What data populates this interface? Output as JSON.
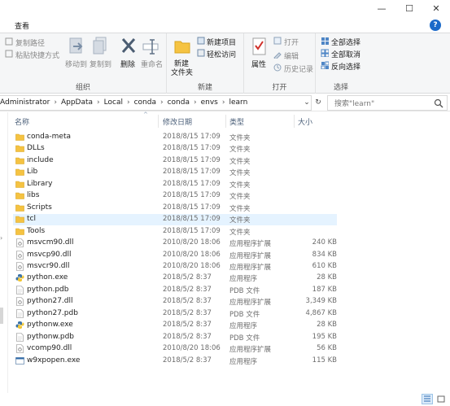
{
  "window": {
    "minimize": "—",
    "maximize": "☐",
    "close": "✕",
    "tab_label": "查看",
    "help": "?"
  },
  "ribbon": {
    "clipboard": {
      "copy_path": "复制路径",
      "paste_shortcut": "粘贴快捷方式",
      "move_to": "移动到",
      "copy_to": "复制到",
      "group_label": "组织"
    },
    "organize": {
      "delete": "删除",
      "rename": "重命名"
    },
    "new": {
      "new_folder_line1": "新建",
      "new_folder_line2": "文件夹",
      "new_item": "新建项目",
      "easy_access": "轻松访问",
      "group_label": "新建"
    },
    "open": {
      "properties": "属性",
      "open": "打开",
      "edit": "编辑",
      "history": "历史记录",
      "group_label": "打开"
    },
    "select": {
      "select_all": "全部选择",
      "select_none": "全部取消",
      "invert": "反向选择",
      "group_label": "选择"
    }
  },
  "address": {
    "crumbs": [
      "Administrator",
      "AppData",
      "Local",
      "conda",
      "conda",
      "envs",
      "learn"
    ],
    "search_placeholder": "搜索\"learn\""
  },
  "columns": {
    "name": "名称",
    "date": "修改日期",
    "type": "类型",
    "size": "大小"
  },
  "files": [
    {
      "name": "conda-meta",
      "date": "2018/8/15 17:09",
      "type": "文件夹",
      "size": "",
      "icon": "folder-icon"
    },
    {
      "name": "DLLs",
      "date": "2018/8/15 17:09",
      "type": "文件夹",
      "size": "",
      "icon": "folder-icon"
    },
    {
      "name": "include",
      "date": "2018/8/15 17:09",
      "type": "文件夹",
      "size": "",
      "icon": "folder-icon"
    },
    {
      "name": "Lib",
      "date": "2018/8/15 17:09",
      "type": "文件夹",
      "size": "",
      "icon": "folder-icon"
    },
    {
      "name": "Library",
      "date": "2018/8/15 17:09",
      "type": "文件夹",
      "size": "",
      "icon": "folder-icon"
    },
    {
      "name": "libs",
      "date": "2018/8/15 17:09",
      "type": "文件夹",
      "size": "",
      "icon": "folder-icon"
    },
    {
      "name": "Scripts",
      "date": "2018/8/15 17:09",
      "type": "文件夹",
      "size": "",
      "icon": "folder-icon"
    },
    {
      "name": "tcl",
      "date": "2018/8/15 17:09",
      "type": "文件夹",
      "size": "",
      "icon": "folder-icon"
    },
    {
      "name": "Tools",
      "date": "2018/8/15 17:09",
      "type": "文件夹",
      "size": "",
      "icon": "folder-icon"
    },
    {
      "name": "msvcm90.dll",
      "date": "2010/8/20 18:06",
      "type": "应用程序扩展",
      "size": "240 KB",
      "icon": "dll-file-icon"
    },
    {
      "name": "msvcp90.dll",
      "date": "2010/8/20 18:06",
      "type": "应用程序扩展",
      "size": "834 KB",
      "icon": "dll-file-icon"
    },
    {
      "name": "msvcr90.dll",
      "date": "2010/8/20 18:06",
      "type": "应用程序扩展",
      "size": "610 KB",
      "icon": "dll-file-icon"
    },
    {
      "name": "python.exe",
      "date": "2018/5/2 8:37",
      "type": "应用程序",
      "size": "28 KB",
      "icon": "python-icon"
    },
    {
      "name": "python.pdb",
      "date": "2018/5/2 8:37",
      "type": "PDB 文件",
      "size": "187 KB",
      "icon": "file-icon"
    },
    {
      "name": "python27.dll",
      "date": "2018/5/2 8:37",
      "type": "应用程序扩展",
      "size": "3,349 KB",
      "icon": "dll-file-icon"
    },
    {
      "name": "python27.pdb",
      "date": "2018/5/2 8:37",
      "type": "PDB 文件",
      "size": "4,867 KB",
      "icon": "file-icon"
    },
    {
      "name": "pythonw.exe",
      "date": "2018/5/2 8:37",
      "type": "应用程序",
      "size": "28 KB",
      "icon": "python-icon"
    },
    {
      "name": "pythonw.pdb",
      "date": "2018/5/2 8:37",
      "type": "PDB 文件",
      "size": "195 KB",
      "icon": "file-icon"
    },
    {
      "name": "vcomp90.dll",
      "date": "2010/8/20 18:06",
      "type": "应用程序扩展",
      "size": "56 KB",
      "icon": "dll-file-icon"
    },
    {
      "name": "w9xpopen.exe",
      "date": "2018/5/2 8:37",
      "type": "应用程序",
      "size": "115 KB",
      "icon": "exe-icon"
    }
  ],
  "selected_index": 7,
  "colors": {
    "folder": "#f5c342",
    "accent": "#1b6ac9",
    "selection": "#e5f3ff"
  }
}
